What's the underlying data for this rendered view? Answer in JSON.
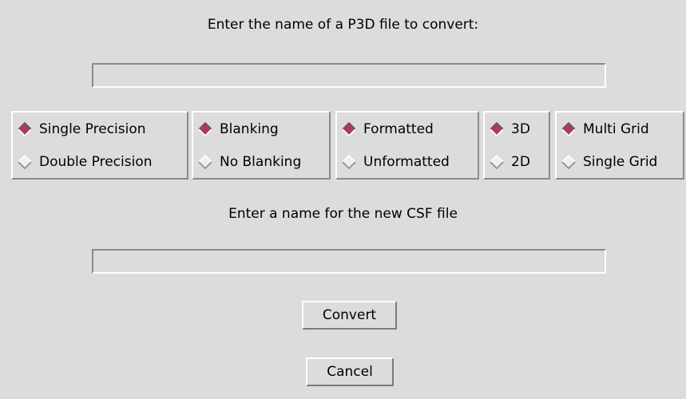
{
  "colors": {
    "background": "#dcdcdc",
    "radio_selected": "#b03a5b",
    "radio_unselected": "#eeeeee"
  },
  "input_prompt": {
    "label": "Enter the name of a P3D file to convert:",
    "value": "",
    "placeholder": ""
  },
  "options": {
    "precision": [
      {
        "label": "Single Precision",
        "selected": true
      },
      {
        "label": "Double Precision",
        "selected": false
      }
    ],
    "blanking": [
      {
        "label": "Blanking",
        "selected": true
      },
      {
        "label": "No Blanking",
        "selected": false
      }
    ],
    "format": [
      {
        "label": "Formatted",
        "selected": true
      },
      {
        "label": "Unformatted",
        "selected": false
      }
    ],
    "dimension": [
      {
        "label": "3D",
        "selected": true
      },
      {
        "label": "2D",
        "selected": false
      }
    ],
    "grid": [
      {
        "label": "Multi Grid",
        "selected": true
      },
      {
        "label": "Single Grid",
        "selected": false
      }
    ]
  },
  "output_prompt": {
    "label": "Enter a name for the new CSF file",
    "value": "",
    "placeholder": ""
  },
  "buttons": {
    "convert": "Convert",
    "cancel": "Cancel"
  }
}
